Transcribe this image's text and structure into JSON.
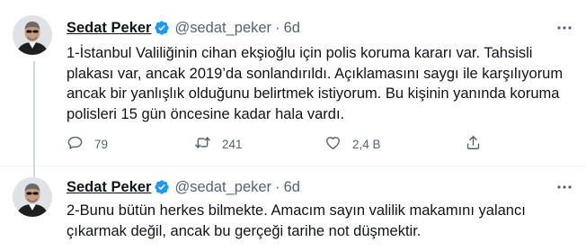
{
  "thread": {
    "tweets": [
      {
        "author": {
          "display_name": "Sedat Peker",
          "handle": "@sedat_peker"
        },
        "separator": "·",
        "time": "6d",
        "text": "1-İstanbul Valiliğinin cihan ekşioğlu için polis koruma kararı var. Tahsisli\nplakası var, ancak 2019’da sonlandırıldı. Açıklamasını saygı ile karşılıyorum\nancak bir yanlışlık olduğunu belirtmek istiyorum. Bu kişinin yanında koruma\npolisleri 15 gün öncesine kadar hala vardı.",
        "actions": {
          "replies": "79",
          "retweets": "241",
          "likes": "2,4 B"
        }
      },
      {
        "author": {
          "display_name": "Sedat Peker",
          "handle": "@sedat_peker"
        },
        "separator": "·",
        "time": "6d",
        "text": "2-Bunu bütün herkes bilmekte. Amacım sayın valilik makamını yalancı\nçıkarmak değil, ancak bu gerçeği tarihe not düşmektir."
      }
    ]
  },
  "icons": {
    "verified": "verified-badge-icon",
    "more": "more-icon",
    "reply": "reply-icon",
    "retweet": "retweet-icon",
    "like": "heart-icon",
    "share": "share-icon"
  },
  "colors": {
    "verified": "#1d9bf0",
    "secondary_text": "#536471",
    "primary_text": "#0f1419",
    "thread_line": "#cfd9de",
    "divider": "#eff3f4"
  }
}
